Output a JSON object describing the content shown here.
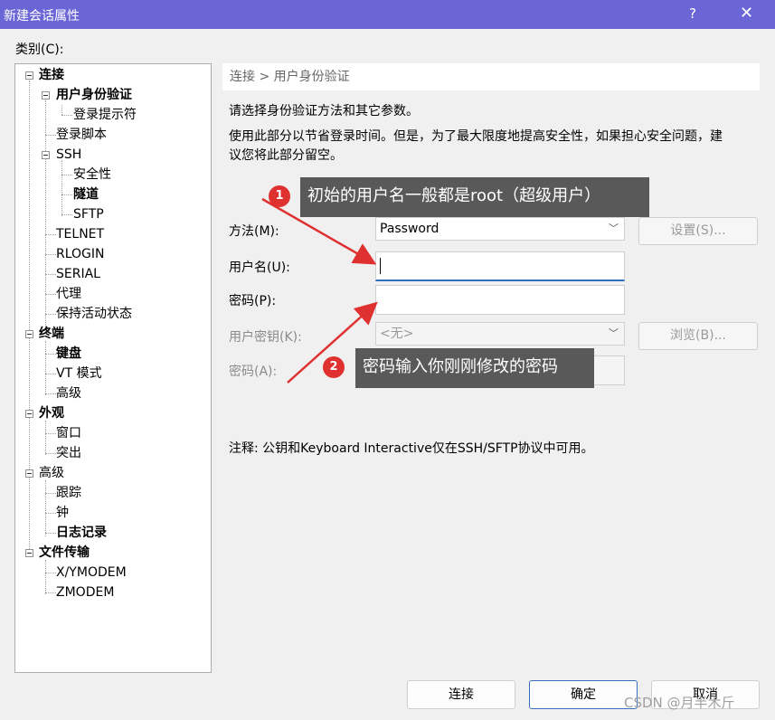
{
  "window": {
    "title": "新建会话属性",
    "help_icon": "?",
    "close_icon": "✕"
  },
  "category_label": "类别(C):",
  "tree": {
    "connection": "连接",
    "user_auth": "用户身份验证",
    "login_prompt": "登录提示符",
    "login_script": "登录脚本",
    "ssh": "SSH",
    "security": "安全性",
    "tunnel": "隧道",
    "sftp": "SFTP",
    "telnet": "TELNET",
    "rlogin": "RLOGIN",
    "serial": "SERIAL",
    "proxy": "代理",
    "keepalive": "保持活动状态",
    "terminal": "终端",
    "keyboard": "键盘",
    "vt_mode": "VT 模式",
    "advanced1": "高级",
    "appearance": "外观",
    "window": "窗口",
    "highlight": "突出",
    "advanced2": "高级",
    "trace": "跟踪",
    "bell": "钟",
    "logging": "日志记录",
    "file_transfer": "文件传输",
    "xymodem": "X/YMODEM",
    "zmodem": "ZMODEM"
  },
  "breadcrumb": "连接 > 用户身份验证",
  "intro": "请选择身份验证方法和其它参数。",
  "desc_line1": "使用此部分以节省登录时间。但是，为了最大限度地提高安全性，如果担心安全问题，建",
  "desc_line2": "议您将此部分留空。",
  "method_label": "方法(M):",
  "method_value": "Password",
  "settings_button": "设置(S)...",
  "username_label": "用户名(U):",
  "username_value": "",
  "password_label": "密码(P):",
  "password_value": "",
  "userkey_label": "用户密钥(K):",
  "userkey_value": "<无>",
  "browse_button": "浏览(B)...",
  "passphrase_label": "密码(A):",
  "note": "注释: 公钥和Keyboard Interactive仅在SSH/SFTP协议中可用。",
  "annotations": [
    {
      "number": "1",
      "text": "初始的用户名一般都是root（超级用户）"
    },
    {
      "number": "2",
      "text": "密码输入你刚刚修改的密码"
    }
  ],
  "buttons": {
    "connect": "连接",
    "ok": "确定",
    "cancel": "取消"
  },
  "watermark": "CSDN @月半木斤",
  "colors": {
    "titlebar": "#6b66d6",
    "annotation_arrow": "#e03131",
    "callout_bg": "#595959"
  }
}
